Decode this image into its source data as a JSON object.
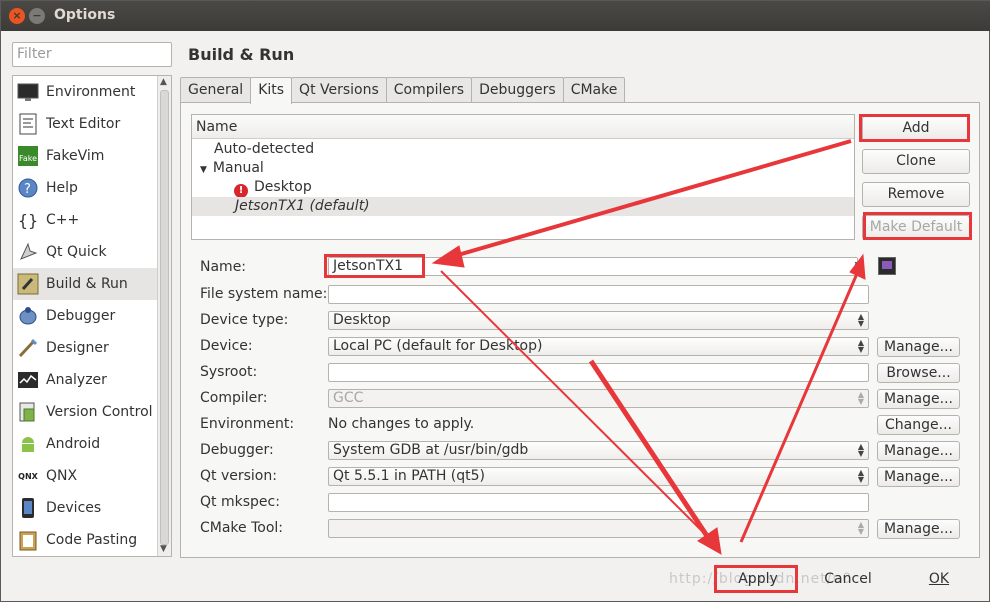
{
  "window": {
    "title": "Options"
  },
  "filter": {
    "placeholder": "Filter"
  },
  "sidebar": {
    "items": [
      {
        "label": "Environment",
        "icon": "monitor-icon"
      },
      {
        "label": "Text Editor",
        "icon": "text-editor-icon"
      },
      {
        "label": "FakeVim",
        "icon": "fakevim-icon"
      },
      {
        "label": "Help",
        "icon": "help-icon"
      },
      {
        "label": "C++",
        "icon": "braces-icon"
      },
      {
        "label": "Qt Quick",
        "icon": "qt-quick-icon"
      },
      {
        "label": "Build & Run",
        "icon": "build-run-icon",
        "selected": true
      },
      {
        "label": "Debugger",
        "icon": "debugger-icon"
      },
      {
        "label": "Designer",
        "icon": "designer-icon"
      },
      {
        "label": "Analyzer",
        "icon": "analyzer-icon"
      },
      {
        "label": "Version Control",
        "icon": "version-control-icon"
      },
      {
        "label": "Android",
        "icon": "android-icon"
      },
      {
        "label": "QNX",
        "icon": "qnx-icon"
      },
      {
        "label": "Devices",
        "icon": "devices-icon"
      },
      {
        "label": "Code Pasting",
        "icon": "code-pasting-icon"
      }
    ]
  },
  "page": {
    "title": "Build & Run"
  },
  "tabs": [
    "General",
    "Kits",
    "Qt Versions",
    "Compilers",
    "Debuggers",
    "CMake"
  ],
  "active_tab": "Kits",
  "kits_tree": {
    "header": "Name",
    "rows": [
      "Auto-detected",
      "Manual",
      "Desktop",
      "JetsonTX1 (default)"
    ]
  },
  "kit_buttons": {
    "add": "Add",
    "clone": "Clone",
    "remove": "Remove",
    "make_default": "Make Default"
  },
  "form": {
    "name": {
      "label": "Name:",
      "value": "JetsonTX1"
    },
    "file_system_name": {
      "label": "File system name:",
      "value": ""
    },
    "device_type": {
      "label": "Device type:",
      "value": "Desktop"
    },
    "device": {
      "label": "Device:",
      "value": "Local PC (default for Desktop)",
      "button": "Manage..."
    },
    "sysroot": {
      "label": "Sysroot:",
      "value": "",
      "button": "Browse..."
    },
    "compiler": {
      "label": "Compiler:",
      "value": "GCC",
      "button": "Manage..."
    },
    "environment": {
      "label": "Environment:",
      "value": "No changes to apply.",
      "button": "Change..."
    },
    "debugger": {
      "label": "Debugger:",
      "value": "System GDB at /usr/bin/gdb",
      "button": "Manage..."
    },
    "qt_version": {
      "label": "Qt version:",
      "value": "Qt 5.5.1 in PATH (qt5)",
      "button": "Manage..."
    },
    "qt_mkspec": {
      "label": "Qt mkspec:",
      "value": ""
    },
    "cmake_tool": {
      "label": "CMake Tool:",
      "value": "",
      "button": "Manage..."
    }
  },
  "dialog_buttons": {
    "apply": "Apply",
    "cancel": "Cancel",
    "ok": "OK"
  },
  "watermark": "http://blog.csdn.net/u0",
  "colors": {
    "annotation_red": "#e8373a",
    "accent": "#e95420"
  }
}
